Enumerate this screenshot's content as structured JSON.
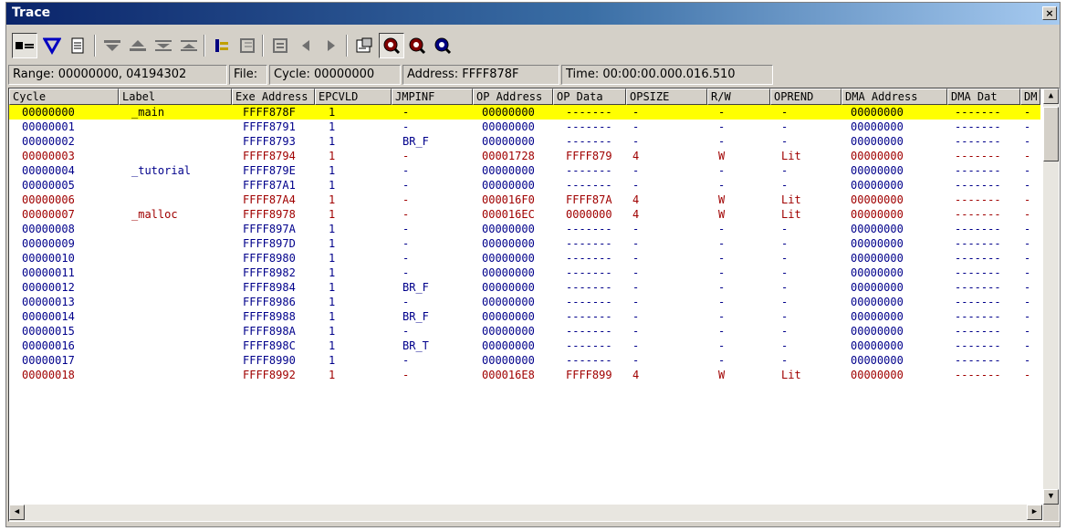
{
  "window": {
    "title": "Trace",
    "close_glyph": "×"
  },
  "toolbar": {
    "buttons": [
      {
        "icon": "acquisition-toggle-icon",
        "pressed": true
      },
      {
        "icon": "filter-icon"
      },
      {
        "icon": "document-icon"
      },
      {
        "icon": "find-next-icon"
      },
      {
        "icon": "find-prev-icon"
      },
      {
        "icon": "first-icon"
      },
      {
        "icon": "last-icon"
      },
      {
        "icon": "tree-view-icon"
      },
      {
        "icon": "source-view-icon"
      },
      {
        "icon": "window-icon"
      },
      {
        "icon": "step-back-icon"
      },
      {
        "icon": "step-forward-icon"
      },
      {
        "icon": "properties-icon"
      },
      {
        "icon": "zoom-in-icon"
      },
      {
        "icon": "zoom-out-icon"
      },
      {
        "icon": "zoom-reset-icon"
      }
    ]
  },
  "status": {
    "range": "Range:  00000000,  04194302",
    "file": "File:",
    "cycle": "Cycle:  00000000",
    "address": "Address: FFFF878F",
    "time": "Time: 00:00:00.000.016.510"
  },
  "columns": [
    "Cycle",
    "Label",
    "Exe Address",
    "EPCVLD",
    "JMPINF",
    "OP Address",
    "OP Data",
    "OPSIZE",
    "R/W",
    "OPREND",
    "DMA Address",
    "DMA Dat",
    "DM"
  ],
  "rows": [
    {
      "c": [
        "00000000",
        "_main",
        "FFFF878F",
        "1",
        "-",
        "00000000",
        "-------",
        "-",
        "-",
        "-",
        "00000000",
        "-------",
        "-"
      ],
      "style": "sel"
    },
    {
      "c": [
        "00000001",
        "",
        "FFFF8791",
        "1",
        "-",
        "00000000",
        "-------",
        "-",
        "-",
        "-",
        "00000000",
        "-------",
        "-"
      ],
      "style": "blue"
    },
    {
      "c": [
        "00000002",
        "",
        "FFFF8793",
        "1",
        "BR_F",
        "00000000",
        "-------",
        "-",
        "-",
        "-",
        "00000000",
        "-------",
        "-"
      ],
      "style": "blue"
    },
    {
      "c": [
        "00000003",
        "",
        "FFFF8794",
        "1",
        "-",
        "00001728",
        "FFFF879",
        "4",
        "W",
        "Lit",
        "00000000",
        "-------",
        "-"
      ],
      "style": "red"
    },
    {
      "c": [
        "00000004",
        "_tutorial",
        "FFFF879E",
        "1",
        "-",
        "00000000",
        "-------",
        "-",
        "-",
        "-",
        "00000000",
        "-------",
        "-"
      ],
      "style": "blue"
    },
    {
      "c": [
        "00000005",
        "",
        "FFFF87A1",
        "1",
        "-",
        "00000000",
        "-------",
        "-",
        "-",
        "-",
        "00000000",
        "-------",
        "-"
      ],
      "style": "blue"
    },
    {
      "c": [
        "00000006",
        "",
        "FFFF87A4",
        "1",
        "-",
        "000016F0",
        "FFFF87A",
        "4",
        "W",
        "Lit",
        "00000000",
        "-------",
        "-"
      ],
      "style": "red"
    },
    {
      "c": [
        "00000007",
        "_malloc",
        "FFFF8978",
        "1",
        "-",
        "000016EC",
        "0000000",
        "4",
        "W",
        "Lit",
        "00000000",
        "-------",
        "-"
      ],
      "style": "red"
    },
    {
      "c": [
        "00000008",
        "",
        "FFFF897A",
        "1",
        "-",
        "00000000",
        "-------",
        "-",
        "-",
        "-",
        "00000000",
        "-------",
        "-"
      ],
      "style": "blue"
    },
    {
      "c": [
        "00000009",
        "",
        "FFFF897D",
        "1",
        "-",
        "00000000",
        "-------",
        "-",
        "-",
        "-",
        "00000000",
        "-------",
        "-"
      ],
      "style": "blue"
    },
    {
      "c": [
        "00000010",
        "",
        "FFFF8980",
        "1",
        "-",
        "00000000",
        "-------",
        "-",
        "-",
        "-",
        "00000000",
        "-------",
        "-"
      ],
      "style": "blue"
    },
    {
      "c": [
        "00000011",
        "",
        "FFFF8982",
        "1",
        "-",
        "00000000",
        "-------",
        "-",
        "-",
        "-",
        "00000000",
        "-------",
        "-"
      ],
      "style": "blue"
    },
    {
      "c": [
        "00000012",
        "",
        "FFFF8984",
        "1",
        "BR_F",
        "00000000",
        "-------",
        "-",
        "-",
        "-",
        "00000000",
        "-------",
        "-"
      ],
      "style": "blue"
    },
    {
      "c": [
        "00000013",
        "",
        "FFFF8986",
        "1",
        "-",
        "00000000",
        "-------",
        "-",
        "-",
        "-",
        "00000000",
        "-------",
        "-"
      ],
      "style": "blue"
    },
    {
      "c": [
        "00000014",
        "",
        "FFFF8988",
        "1",
        "BR_F",
        "00000000",
        "-------",
        "-",
        "-",
        "-",
        "00000000",
        "-------",
        "-"
      ],
      "style": "blue"
    },
    {
      "c": [
        "00000015",
        "",
        "FFFF898A",
        "1",
        "-",
        "00000000",
        "-------",
        "-",
        "-",
        "-",
        "00000000",
        "-------",
        "-"
      ],
      "style": "blue"
    },
    {
      "c": [
        "00000016",
        "",
        "FFFF898C",
        "1",
        "BR_T",
        "00000000",
        "-------",
        "-",
        "-",
        "-",
        "00000000",
        "-------",
        "-"
      ],
      "style": "blue"
    },
    {
      "c": [
        "00000017",
        "",
        "FFFF8990",
        "1",
        "-",
        "00000000",
        "-------",
        "-",
        "-",
        "-",
        "00000000",
        "-------",
        "-"
      ],
      "style": "blue"
    },
    {
      "c": [
        "00000018",
        "",
        "FFFF8992",
        "1",
        "-",
        "000016E8",
        "FFFF899",
        "4",
        "W",
        "Lit",
        "00000000",
        "-------",
        "-"
      ],
      "style": "red"
    }
  ],
  "scroll": {
    "up": "▲",
    "down": "▼",
    "left": "◀",
    "right": "▶"
  }
}
